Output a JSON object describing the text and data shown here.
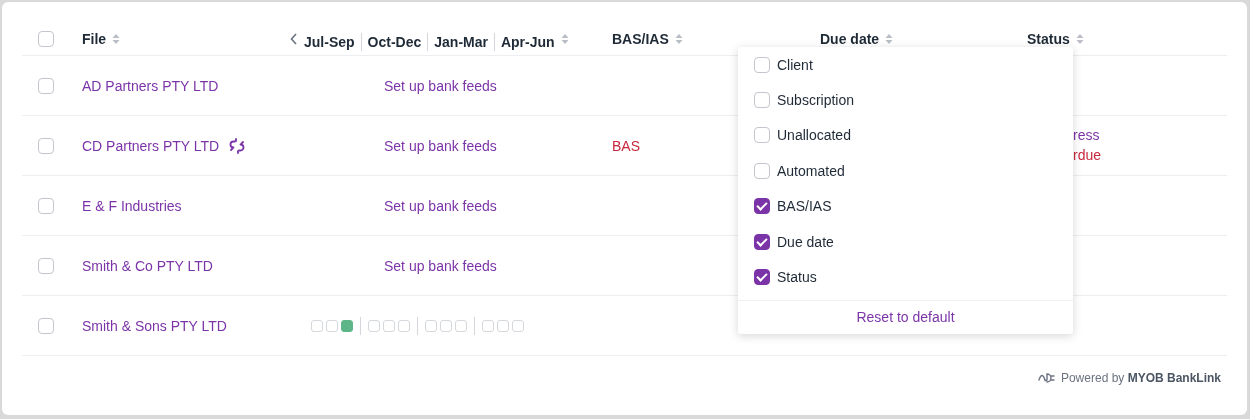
{
  "table": {
    "header": {
      "select_all": {
        "checked": false
      },
      "file": "File",
      "quarters": [
        "Jul-Sep",
        "Oct-Dec",
        "Jan-Mar",
        "Apr-Jun"
      ],
      "bas": "BAS/IAS",
      "due": "Due date",
      "status": "Status"
    },
    "rows": [
      {
        "checked": false,
        "file": "AD Partners PTY LTD",
        "link_warning": false,
        "quarters": {
          "kind": "action",
          "text": "Set up bank feeds"
        }
      },
      {
        "checked": false,
        "file": "CD Partners PTY LTD",
        "link_warning": true,
        "quarters": {
          "kind": "action",
          "text": "Set up bank feeds"
        },
        "bas": {
          "text": "BAS",
          "color": "#c8283e"
        },
        "status": [
          {
            "text": "ress",
            "color": "#7b34a8"
          },
          {
            "text": "rdue",
            "color": "#c8283e"
          }
        ]
      },
      {
        "checked": false,
        "file": "E & F Industries",
        "link_warning": false,
        "quarters": {
          "kind": "action",
          "text": "Set up bank feeds"
        }
      },
      {
        "checked": false,
        "file": "Smith & Co PTY LTD",
        "link_warning": false,
        "quarters": {
          "kind": "action",
          "text": "Set up bank feeds"
        }
      },
      {
        "checked": false,
        "file": "Smith & Sons PTY LTD",
        "link_warning": false,
        "quarters": {
          "kind": "boxes",
          "groups": [
            {
              "boxes": [
                {
                  "filled": false
                },
                {
                  "filled": false
                },
                {
                  "filled": true
                }
              ]
            },
            {
              "boxes": [
                {
                  "filled": false
                },
                {
                  "filled": false
                },
                {
                  "filled": false
                }
              ]
            },
            {
              "boxes": [
                {
                  "filled": false
                },
                {
                  "filled": false
                },
                {
                  "filled": false
                }
              ]
            },
            {
              "boxes": [
                {
                  "filled": false
                },
                {
                  "filled": false
                },
                {
                  "filled": false
                }
              ]
            }
          ]
        }
      }
    ]
  },
  "column_menu": {
    "items": [
      {
        "label": "Client",
        "checked": false
      },
      {
        "label": "Subscription",
        "checked": false
      },
      {
        "label": "Unallocated",
        "checked": false
      },
      {
        "label": "Automated",
        "checked": false
      },
      {
        "label": "BAS/IAS",
        "checked": true
      },
      {
        "label": "Due date",
        "checked": true
      },
      {
        "label": "Status",
        "checked": true
      }
    ],
    "reset": "Reset to default"
  },
  "footer": {
    "text": "Powered by **MYOB BankLink**"
  }
}
